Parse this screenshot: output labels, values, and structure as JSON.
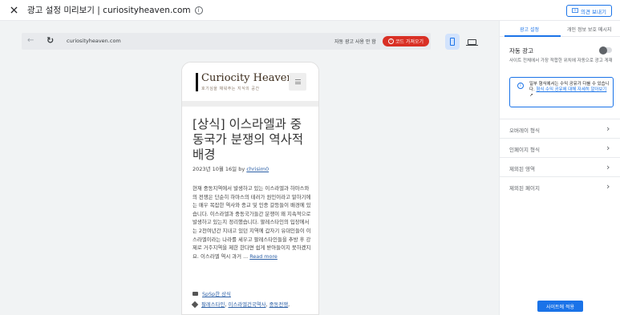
{
  "header": {
    "title": "광고 설정 미리보기 | curiosityheaven.com",
    "info_icon": "info-icon",
    "feedback_label": "의견 보내기",
    "close_icon": "close-icon"
  },
  "browser": {
    "url": "curiosityheaven.com",
    "auto_ads_status": "자동 광고 사용 안 함",
    "get_code_label": "코드 가져오기",
    "icons": [
      "back-arrow-icon",
      "reload-icon",
      "mobile-device-icon",
      "desktop-device-icon"
    ]
  },
  "site": {
    "logo_title": "Curiocity Heaven",
    "logo_subtitle": "호기심을 채워주는 지식의 공간",
    "post": {
      "title": "[상식] 이스라엘과 중동국가 분쟁의 역사적 배경",
      "date": "2023년 10월 16일",
      "by": "by",
      "author": "chrisim0",
      "body": "현재 중동지역에서 발생하고 있는 이스라엘과 하마스와의 전쟁은 단순히 하마스의 테러가 원인이라고 말하기에는 매우 복잡한 역사와 종교 및 인종 갈등들이 배경에 있습니다. 이스라엘과 중동국가들간 분쟁이 왜 지속적으로 발생하고 있는지 정리했습니다.      팔레스타인의 입장에서는 2천여년간 지내고 있던 지역에 갑자기 유대인들이 이스라엘이라는 나라를 세우고 팔레스타인들을 추방 후 강제로 거주지역을 제한 한다면 쉽게 받아들이지 못하겠지요. 이스라엘 역시 과거 ...",
      "read_more": "Read more",
      "category": "SpSp한 상식",
      "tags": [
        "팔레스타인",
        "이스라엘건국역사",
        "중동전쟁"
      ]
    }
  },
  "panel": {
    "tabs": [
      {
        "label": "광고 설정",
        "active": true
      },
      {
        "label": "개인 정보 보호 메시지",
        "active": false
      }
    ],
    "auto_ads_title": "자동 광고",
    "auto_ads_desc": "사이트 전체에서 가장 적합한 위치에 자동으로 광고 게재",
    "auto_ads_enabled": false,
    "notice_text": "일부 형식에서는 수익 공유가 다를 수 있습니다.",
    "notice_link": "형식 수익 공유에 대해 자세히 알아보기",
    "rows": [
      "오버레이 형식",
      "인페이지 형식",
      "제외된 영역",
      "제외된 페이지"
    ],
    "apply_label": "사이트에 적용",
    "accent": "#1a73e8",
    "danger": "#d93025"
  }
}
